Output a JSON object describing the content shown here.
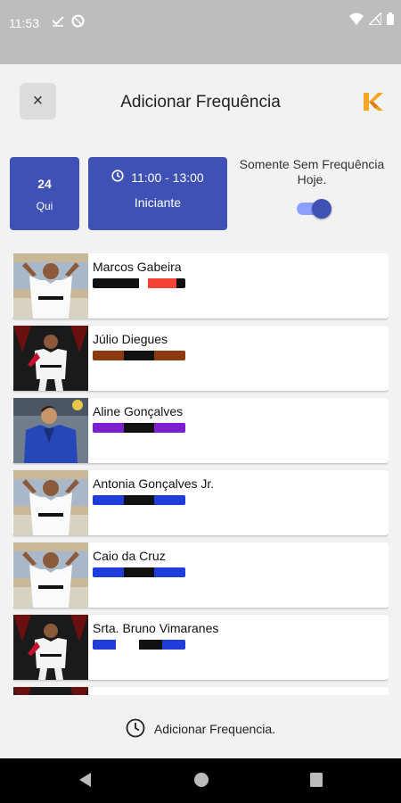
{
  "status_bar": {
    "time": "11:53"
  },
  "header": {
    "title": "Adicionar Frequência",
    "close_label": "×"
  },
  "session": {
    "day": "24",
    "weekday": "Qui",
    "time": "11:00 - 13:00",
    "level": "Iniciante"
  },
  "filter": {
    "label": "Somente Sem Frequência Hoje.",
    "enabled": true
  },
  "students": [
    {
      "name": "Marcos Gabeira",
      "belt": [
        "#111111",
        "#111111",
        "#111111",
        "#111111",
        "#111111",
        "#ffffff",
        "#f44336",
        "#f44336",
        "#f44336",
        "#111111"
      ],
      "photo": "a"
    },
    {
      "name": "Júlio Diegues",
      "belt": [
        "#8b3a0f",
        "#111111",
        "#8b3a0f"
      ],
      "photo": "b"
    },
    {
      "name": "Aline Gonçalves",
      "belt": [
        "#7b1fd1",
        "#111111",
        "#7b1fd1"
      ],
      "photo": "c"
    },
    {
      "name": "Antonia Gonçalves Jr.",
      "belt": [
        "#1e3ddb",
        "#111111",
        "#1e3ddb"
      ],
      "photo": "a"
    },
    {
      "name": "Caio da Cruz",
      "belt": [
        "#1e3ddb",
        "#111111",
        "#1e3ddb"
      ],
      "photo": "a"
    },
    {
      "name": "Srta. Bruno Vimaranes",
      "belt": [
        "#1e3ddb",
        "#ffffff",
        "#111111",
        "#1e3ddb"
      ],
      "photo": "b"
    }
  ],
  "bottom": {
    "action_label": "Adicionar Frequencia."
  },
  "colors": {
    "primary": "#3f51b5",
    "brand": "#f5a623"
  }
}
